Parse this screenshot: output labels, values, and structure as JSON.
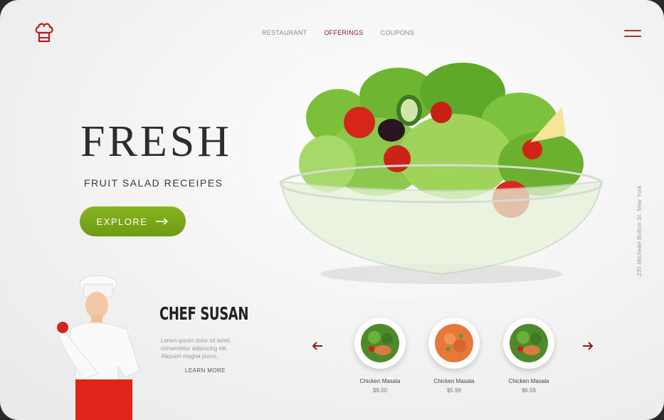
{
  "nav": {
    "items": [
      {
        "label": "RESTAURANT",
        "active": false
      },
      {
        "label": "OFFERINGS",
        "active": true
      },
      {
        "label": "COUPONS",
        "active": false
      }
    ]
  },
  "icons": {
    "logo": "chef-hat-icon",
    "menu": "hamburger-menu-icon",
    "prev": "arrow-left-icon",
    "next": "arrow-right-icon",
    "explore": "arrow-right-icon"
  },
  "hero": {
    "title": "FRESH",
    "subtitle": "FRUIT SALAD RECEIPES",
    "explore_label": "EXPLORE"
  },
  "address": "235 Michelel Bolton St. New York",
  "chef": {
    "name": "CHEF SUSAN",
    "description": "Lorem ipsum dolor sit amet, consectetur adipiscing elit. Aliquam magna purus,",
    "learn_more": "LEARN MORE"
  },
  "dishes": [
    {
      "name": "Chicken Masala",
      "price": "$9.00"
    },
    {
      "name": "Chicken Masala",
      "price": "$5.99"
    },
    {
      "name": "Chicken Masala",
      "price": "$6.59"
    }
  ],
  "colors": {
    "accent": "#8b1a1a",
    "button": "#78a618",
    "text": "#2d2d2d"
  }
}
